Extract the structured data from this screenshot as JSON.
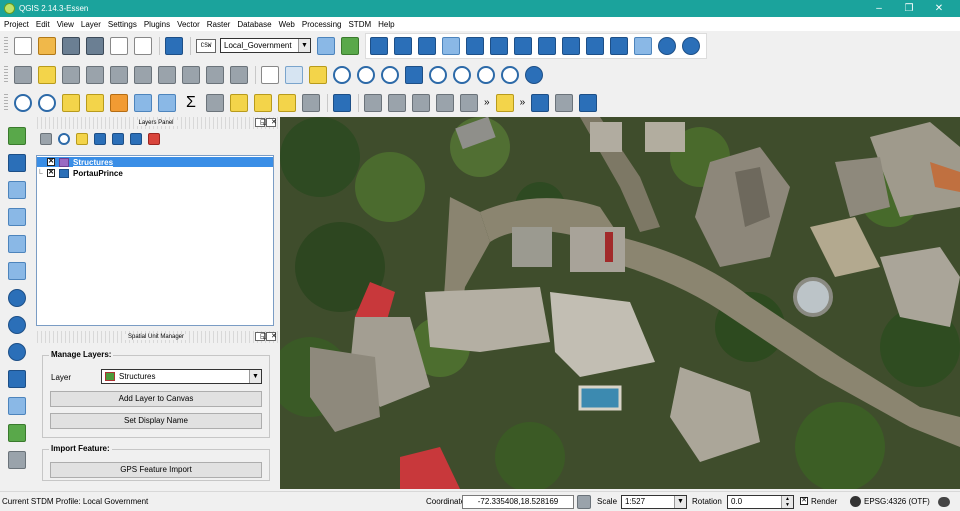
{
  "window": {
    "title": "QGIS 2.14.3-Essen",
    "controls": [
      "–",
      "❐",
      "✕"
    ]
  },
  "menu": [
    "Project",
    "Edit",
    "View",
    "Layer",
    "Settings",
    "Plugins",
    "Vector",
    "Raster",
    "Database",
    "Web",
    "Processing",
    "STDM",
    "Help"
  ],
  "toolbar": {
    "csw_label": "CSW",
    "profile_combo": "Local_Government",
    "icons_row1": [
      "new-project-icon",
      "open-project-icon",
      "save-project-icon",
      "save-as-icon",
      "new-print-composer-icon",
      "composer-manager-icon",
      "help-icon"
    ],
    "stdm_icons": [
      "stdm-manager-icon",
      "stdm-layers-icon",
      "stdm-entities-icon",
      "stdm-spatial-unit-icon",
      "stdm-documents-icon",
      "stdm-import-icon",
      "stdm-export-icon",
      "stdm-reports-icon",
      "stdm-templates-icon",
      "stdm-composer-icon",
      "stdm-users-icon",
      "stdm-logout-icon",
      "stdm-help-icon",
      "stdm-about-icon"
    ],
    "more_indicator": "»"
  },
  "layers_panel": {
    "title": "Layers Panel",
    "layers": [
      {
        "name": "Structures",
        "checked": true,
        "selected": true,
        "color": "#8a5cc0"
      },
      {
        "name": "PortauPrince",
        "checked": true,
        "selected": false,
        "color": "#2f5f9e"
      }
    ]
  },
  "spatial_unit_manager": {
    "title": "Spatial Unit Manager",
    "manage_layers_title": "Manage Layers:",
    "layer_label": "Layer",
    "layer_value": "Structures",
    "add_layer_button": "Add Layer to Canvas",
    "set_display_name_button": "Set Display Name",
    "import_feature_title": "Import Feature:",
    "gps_import_button": "GPS Feature Import"
  },
  "status": {
    "profile_text": "Current STDM Profile: Local Government",
    "coordinate_label": "Coordinate",
    "coordinate_value": "-72.335408,18.528169",
    "scale_label": "Scale",
    "scale_value": "1:527",
    "rotation_label": "Rotation",
    "rotation_value": "0.0",
    "render_label": "Render",
    "crs_label": "EPSG:4326 (OTF)"
  },
  "map": {
    "description_layer": "PortauPrince"
  }
}
